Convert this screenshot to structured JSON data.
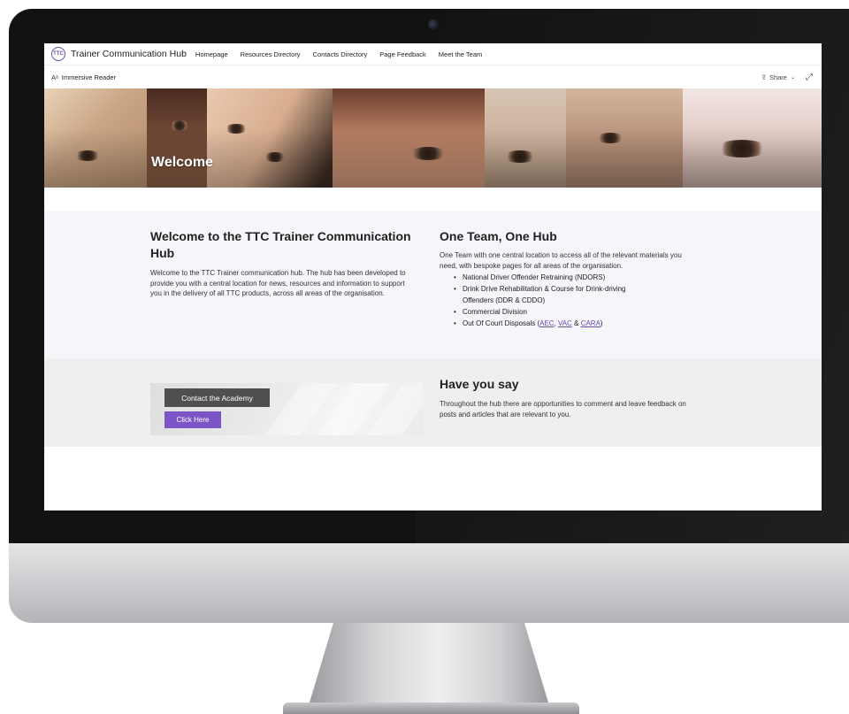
{
  "site": {
    "logo_text": "TTC",
    "title": "Trainer Communication Hub",
    "nav": [
      {
        "label": "Homepage"
      },
      {
        "label": "Resources Directory"
      },
      {
        "label": "Contacts Directory"
      },
      {
        "label": "Page Feedback"
      },
      {
        "label": "Meet the Team"
      }
    ]
  },
  "command_bar": {
    "reader_icon": "Aᵃ",
    "immersive_reader": "Immersive Reader",
    "share_label": "Share",
    "share_icon": "share-icon",
    "expand_icon": "expand-icon"
  },
  "hero": {
    "title": "Welcome"
  },
  "section_one": {
    "welcome_heading": "Welcome to the TTC Trainer Communication Hub",
    "welcome_body": "Welcome to the TTC Trainer communication hub. The hub has been developed to provide you with a central location for news, resources and information to support you in the delivery of all TTC products, across all areas of the organisation.",
    "team_heading": "One Team, One Hub",
    "team_body": "One Team with one central location to access all of the relevant materials you need, with bespoke pages for all areas of the organisation.",
    "list": [
      "National Driver Offender Retraining (NDORS)",
      "Drink Drive Rehabilitation & Course for Drink-driving Offenders (DDR & CDDO)",
      "Commercial Division"
    ],
    "last_item": {
      "prefix": "Out Of Court Disposals (",
      "link1": "AEC",
      "sep1": ", ",
      "link2": "VAC",
      "sep2": " & ",
      "link3": "CARA",
      "suffix": ")"
    }
  },
  "section_two": {
    "contact_button": "Contact the Academy",
    "click_button": "Click Here",
    "feedback_heading": "Have you say",
    "feedback_body": "Throughout the hub there are opportunities to comment and leave feedback on posts and articles that are relevant to you."
  },
  "colors": {
    "accent": "#7b55c6",
    "link": "#6b4aa8",
    "section_one_bg": "#f5f5fa",
    "section_two_bg": "#efefef",
    "contact_button_bg": "#4f4f4f"
  }
}
